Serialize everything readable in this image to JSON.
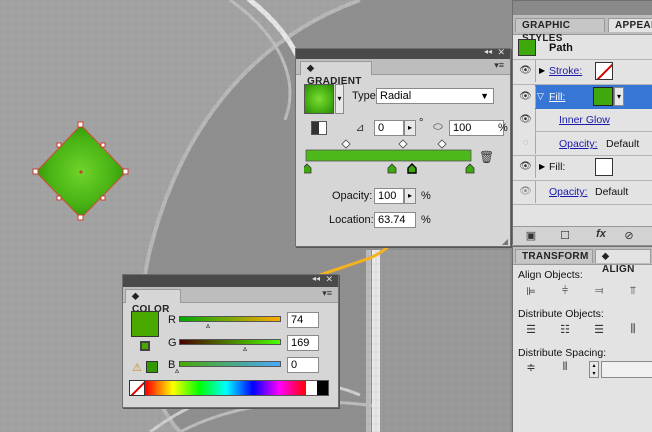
{
  "colors": {
    "canvas_bg": "#8c8c8c",
    "swatch_green": "#3ea80c",
    "selection_blue": "#3876d6",
    "annotation_orange": "#f4b21f",
    "panel_bg": "#d6d6d6"
  },
  "gradient_panel": {
    "title": "GRADIENT",
    "type_label": "Type:",
    "type_value": "Radial",
    "angle_value": "0",
    "degree_symbol": "°",
    "aspect_value": "100",
    "aspect_unit": "%",
    "opacity_label": "Opacity:",
    "opacity_value": "100",
    "opacity_unit": "%",
    "location_label": "Location:",
    "location_value": "63.74",
    "location_unit": "%",
    "icons": [
      "reverse-gradient-icon",
      "angle-icon",
      "aspect-ratio-icon",
      "delete-stop-icon",
      "panel-menu-icon",
      "collapse-icon",
      "close-icon"
    ]
  },
  "color_panel": {
    "title": "COLOR",
    "r_label": "R",
    "r_value": "74",
    "r_level": 0.29,
    "g_label": "G",
    "g_value": "169",
    "g_level": 0.66,
    "b_label": "B",
    "b_value": "0",
    "b_level": 0.0,
    "icons": [
      "out-of-gamut-warning-icon",
      "none-swatch-icon",
      "color-spectrum-icon"
    ]
  },
  "appearance_panel": {
    "tabs": [
      "GRAPHIC STYLES",
      "APPEAR"
    ],
    "item_title": "Path",
    "rows": [
      {
        "label": "Stroke:",
        "swatch": "none"
      },
      {
        "label": "Fill:",
        "swatch": "green",
        "selected": true
      },
      {
        "label": "Inner Glow"
      },
      {
        "label": "Opacity:",
        "value": "Default"
      },
      {
        "label": "Fill:",
        "swatch": "white"
      },
      {
        "label": "Opacity:",
        "value": "Default"
      }
    ],
    "footer_icons": [
      "new-art-icon",
      "clear-icon",
      "fx-icon",
      "no-icon"
    ],
    "fx_label": "fx"
  },
  "align_panel": {
    "tabs": [
      "TRANSFORM",
      "ALIGN"
    ],
    "align_objects_label": "Align Objects:",
    "distribute_objects_label": "Distribute Objects:",
    "distribute_spacing_label": "Distribute Spacing:"
  }
}
